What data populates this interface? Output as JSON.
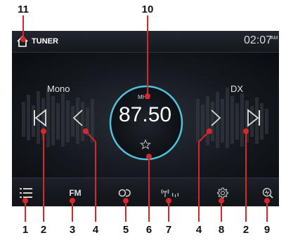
{
  "callouts": {
    "top": [
      {
        "n": "11"
      },
      {
        "n": "10"
      }
    ],
    "bottom": [
      "1",
      "2",
      "3",
      "4",
      "5",
      "6",
      "7",
      "4",
      "8",
      "2",
      "9"
    ]
  },
  "header": {
    "title": "TUNER",
    "clock": "02:07",
    "clock_suffix": "AM",
    "home_icon": "home-icon"
  },
  "tuner": {
    "mode_left": "Mono",
    "mode_right": "DX",
    "unit": "MHz",
    "frequency": "87.50",
    "accent": "#4fc3e0",
    "favorite_icon": "star-outline-icon",
    "controls": {
      "skip_back_icon": "skip-back-icon",
      "seek_back_icon": "chevron-left-icon",
      "seek_fwd_icon": "chevron-right-icon",
      "skip_fwd_icon": "skip-forward-icon"
    }
  },
  "bottom_bar": {
    "list_icon": "list-icon",
    "band_label": "FM",
    "stereo_icon": "stereo-icon",
    "signal_icon": "antenna-signal-icon",
    "settings_icon": "gear-icon",
    "scan_icon": "search-scan-icon"
  },
  "callout_color": "#d8262a"
}
